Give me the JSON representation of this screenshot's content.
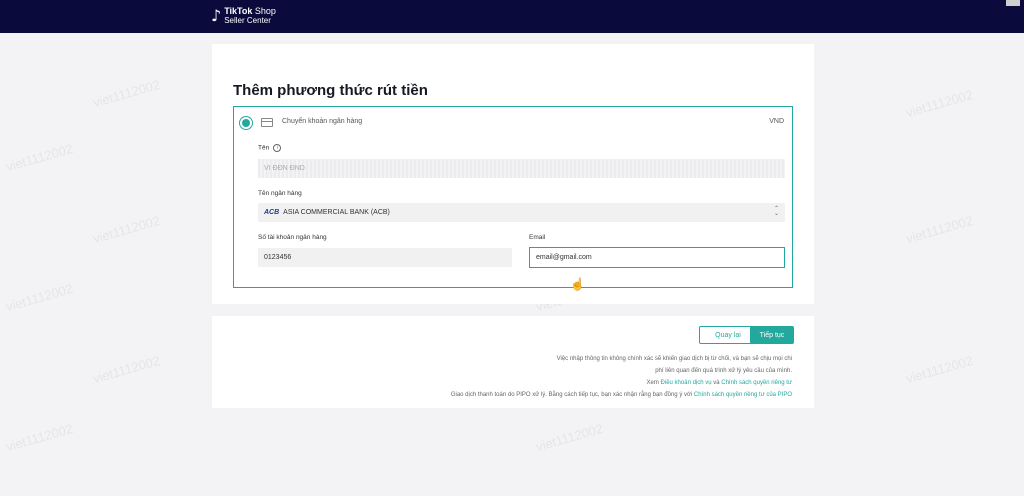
{
  "header": {
    "brand_line1_bold": "TikTok",
    "brand_line1_rest": " Shop",
    "brand_line2": "Seller Center"
  },
  "page": {
    "title": "Thêm phương thức rút tiền"
  },
  "method": {
    "label": "Chuyển khoản ngân hàng",
    "currency": "VND"
  },
  "form": {
    "name_label": "Tên",
    "name_value": "VI ĐĐN ĐND",
    "bank_label": "Tên ngân hàng",
    "bank_logo": "ACB",
    "bank_value": "ASIA COMMERCIAL BANK (ACB)",
    "account_label": "Số tài khoản ngân hàng",
    "account_value": "0123456",
    "email_label": "Email",
    "email_value": "email@gmail.com"
  },
  "actions": {
    "back_label": "Quay lại",
    "next_label": "Tiếp tục"
  },
  "notes": {
    "line1": "Việc nhập thông tin không chính xác sẽ khiến giao dịch bị từ chối, và bạn sẽ chịu mọi chi",
    "line2": "phí liên quan đến quá trình xử lý yêu cầu của mình.",
    "line3_prefix": "Xem ",
    "line3_link1": "Điều khoản dịch vụ",
    "line3_mid": " và ",
    "line3_link2": "Chính sách quyền riêng tư",
    "line4_prefix": "Giao dịch thanh toán do PIPO xử lý. Bằng cách tiếp tục, bạn xác nhận rằng bạn đồng ý với ",
    "line4_link": "Chính sách quyền riêng tư của PIPO"
  },
  "watermark": "viet1112002",
  "colors": {
    "accent": "#23a89e",
    "topbar": "#0b0a3d"
  },
  "icons": [
    "tiktok-note-icon",
    "bank-card-icon",
    "info-icon",
    "chevron-updown-icon",
    "hand-cursor-icon"
  ]
}
